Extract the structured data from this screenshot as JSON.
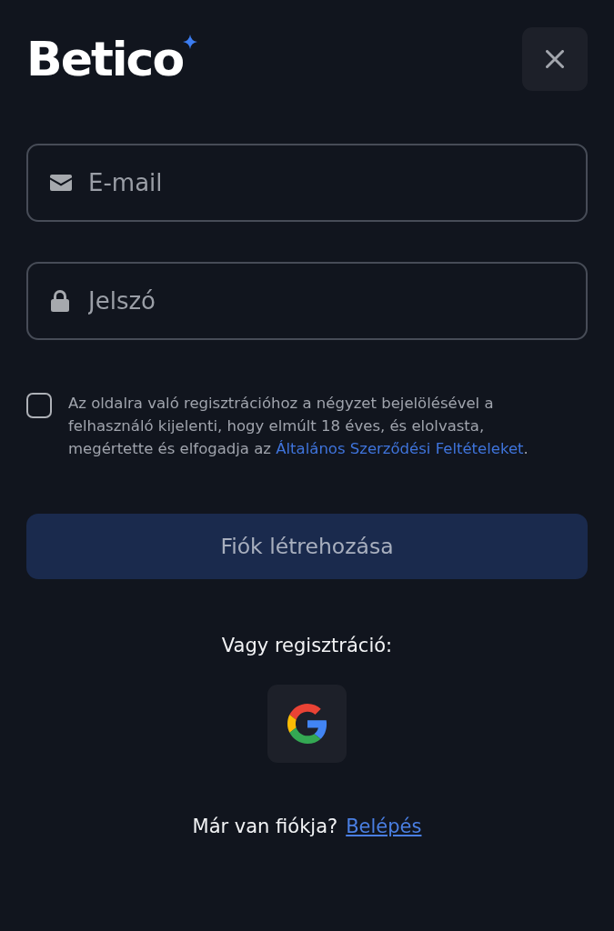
{
  "header": {
    "logo": "Betico"
  },
  "email": {
    "placeholder": "E-mail"
  },
  "password": {
    "placeholder": "Jelszó"
  },
  "terms": {
    "checked": false,
    "text": "Az oldalra való regisztrációhoz a négyzet bejelölésével a felhasználó kijelenti, hogy elmúlt 18 éves, és elolvasta, megértette és elfogadja az ",
    "link": "Általános Szerződési Feltételeket",
    "end": "."
  },
  "submit": {
    "label": "Fiók létrehozása",
    "disabled": true
  },
  "social": {
    "label": "Vagy regisztráció:",
    "providers": [
      {
        "kind": "google"
      }
    ]
  },
  "login": {
    "question": "Már van fiókja?",
    "link": "Belépés"
  }
}
